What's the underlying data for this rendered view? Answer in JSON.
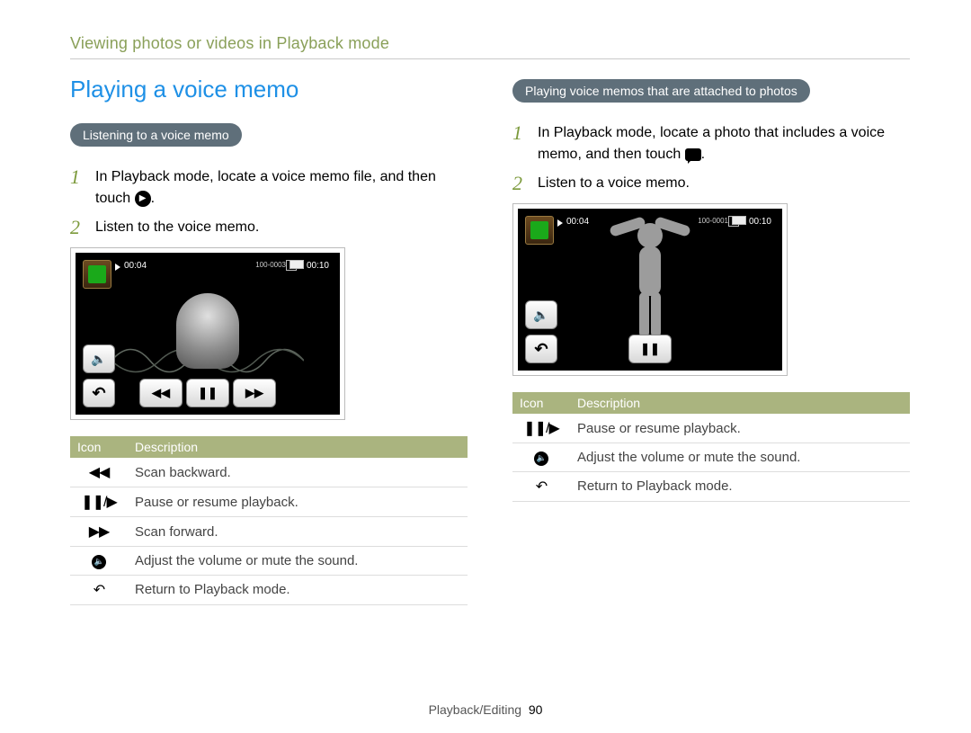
{
  "breadcrumb": "Viewing photos or videos in Playback mode",
  "heading": "Playing a voice memo",
  "left": {
    "pill": "Listening to a voice memo",
    "steps": [
      "In Playback mode, locate a voice memo file, and then touch",
      "Listen to the voice memo."
    ],
    "step1_suffix": ".",
    "screen": {
      "time_cur": "00:04",
      "time_end": "00:10",
      "file_no": "100-0003"
    },
    "table": {
      "headers": [
        "Icon",
        "Description"
      ],
      "rows": [
        {
          "icon": "scan-backward-icon",
          "label": "Scan backward."
        },
        {
          "icon": "pause-play-icon",
          "label": "Pause or resume playback."
        },
        {
          "icon": "scan-forward-icon",
          "label": "Scan forward."
        },
        {
          "icon": "volume-icon",
          "label": "Adjust the volume or mute the sound."
        },
        {
          "icon": "return-icon",
          "label": "Return to Playback mode."
        }
      ]
    }
  },
  "right": {
    "pill": "Playing voice memos that are attached to photos",
    "step1_a": "In Playback mode, locate a photo that includes a voice memo, and then touch",
    "step1_suffix": ".",
    "step2": "Listen to a voice memo.",
    "screen": {
      "time_cur": "00:04",
      "time_end": "00:10",
      "file_no": "100-0001"
    },
    "table": {
      "headers": [
        "Icon",
        "Description"
      ],
      "rows": [
        {
          "icon": "pause-play-icon",
          "label": "Pause or resume playback."
        },
        {
          "icon": "volume-icon",
          "label": "Adjust the volume or mute the sound."
        },
        {
          "icon": "return-icon",
          "label": "Return to Playback mode."
        }
      ]
    }
  },
  "footer": {
    "section": "Playback/Editing",
    "page": "90"
  }
}
